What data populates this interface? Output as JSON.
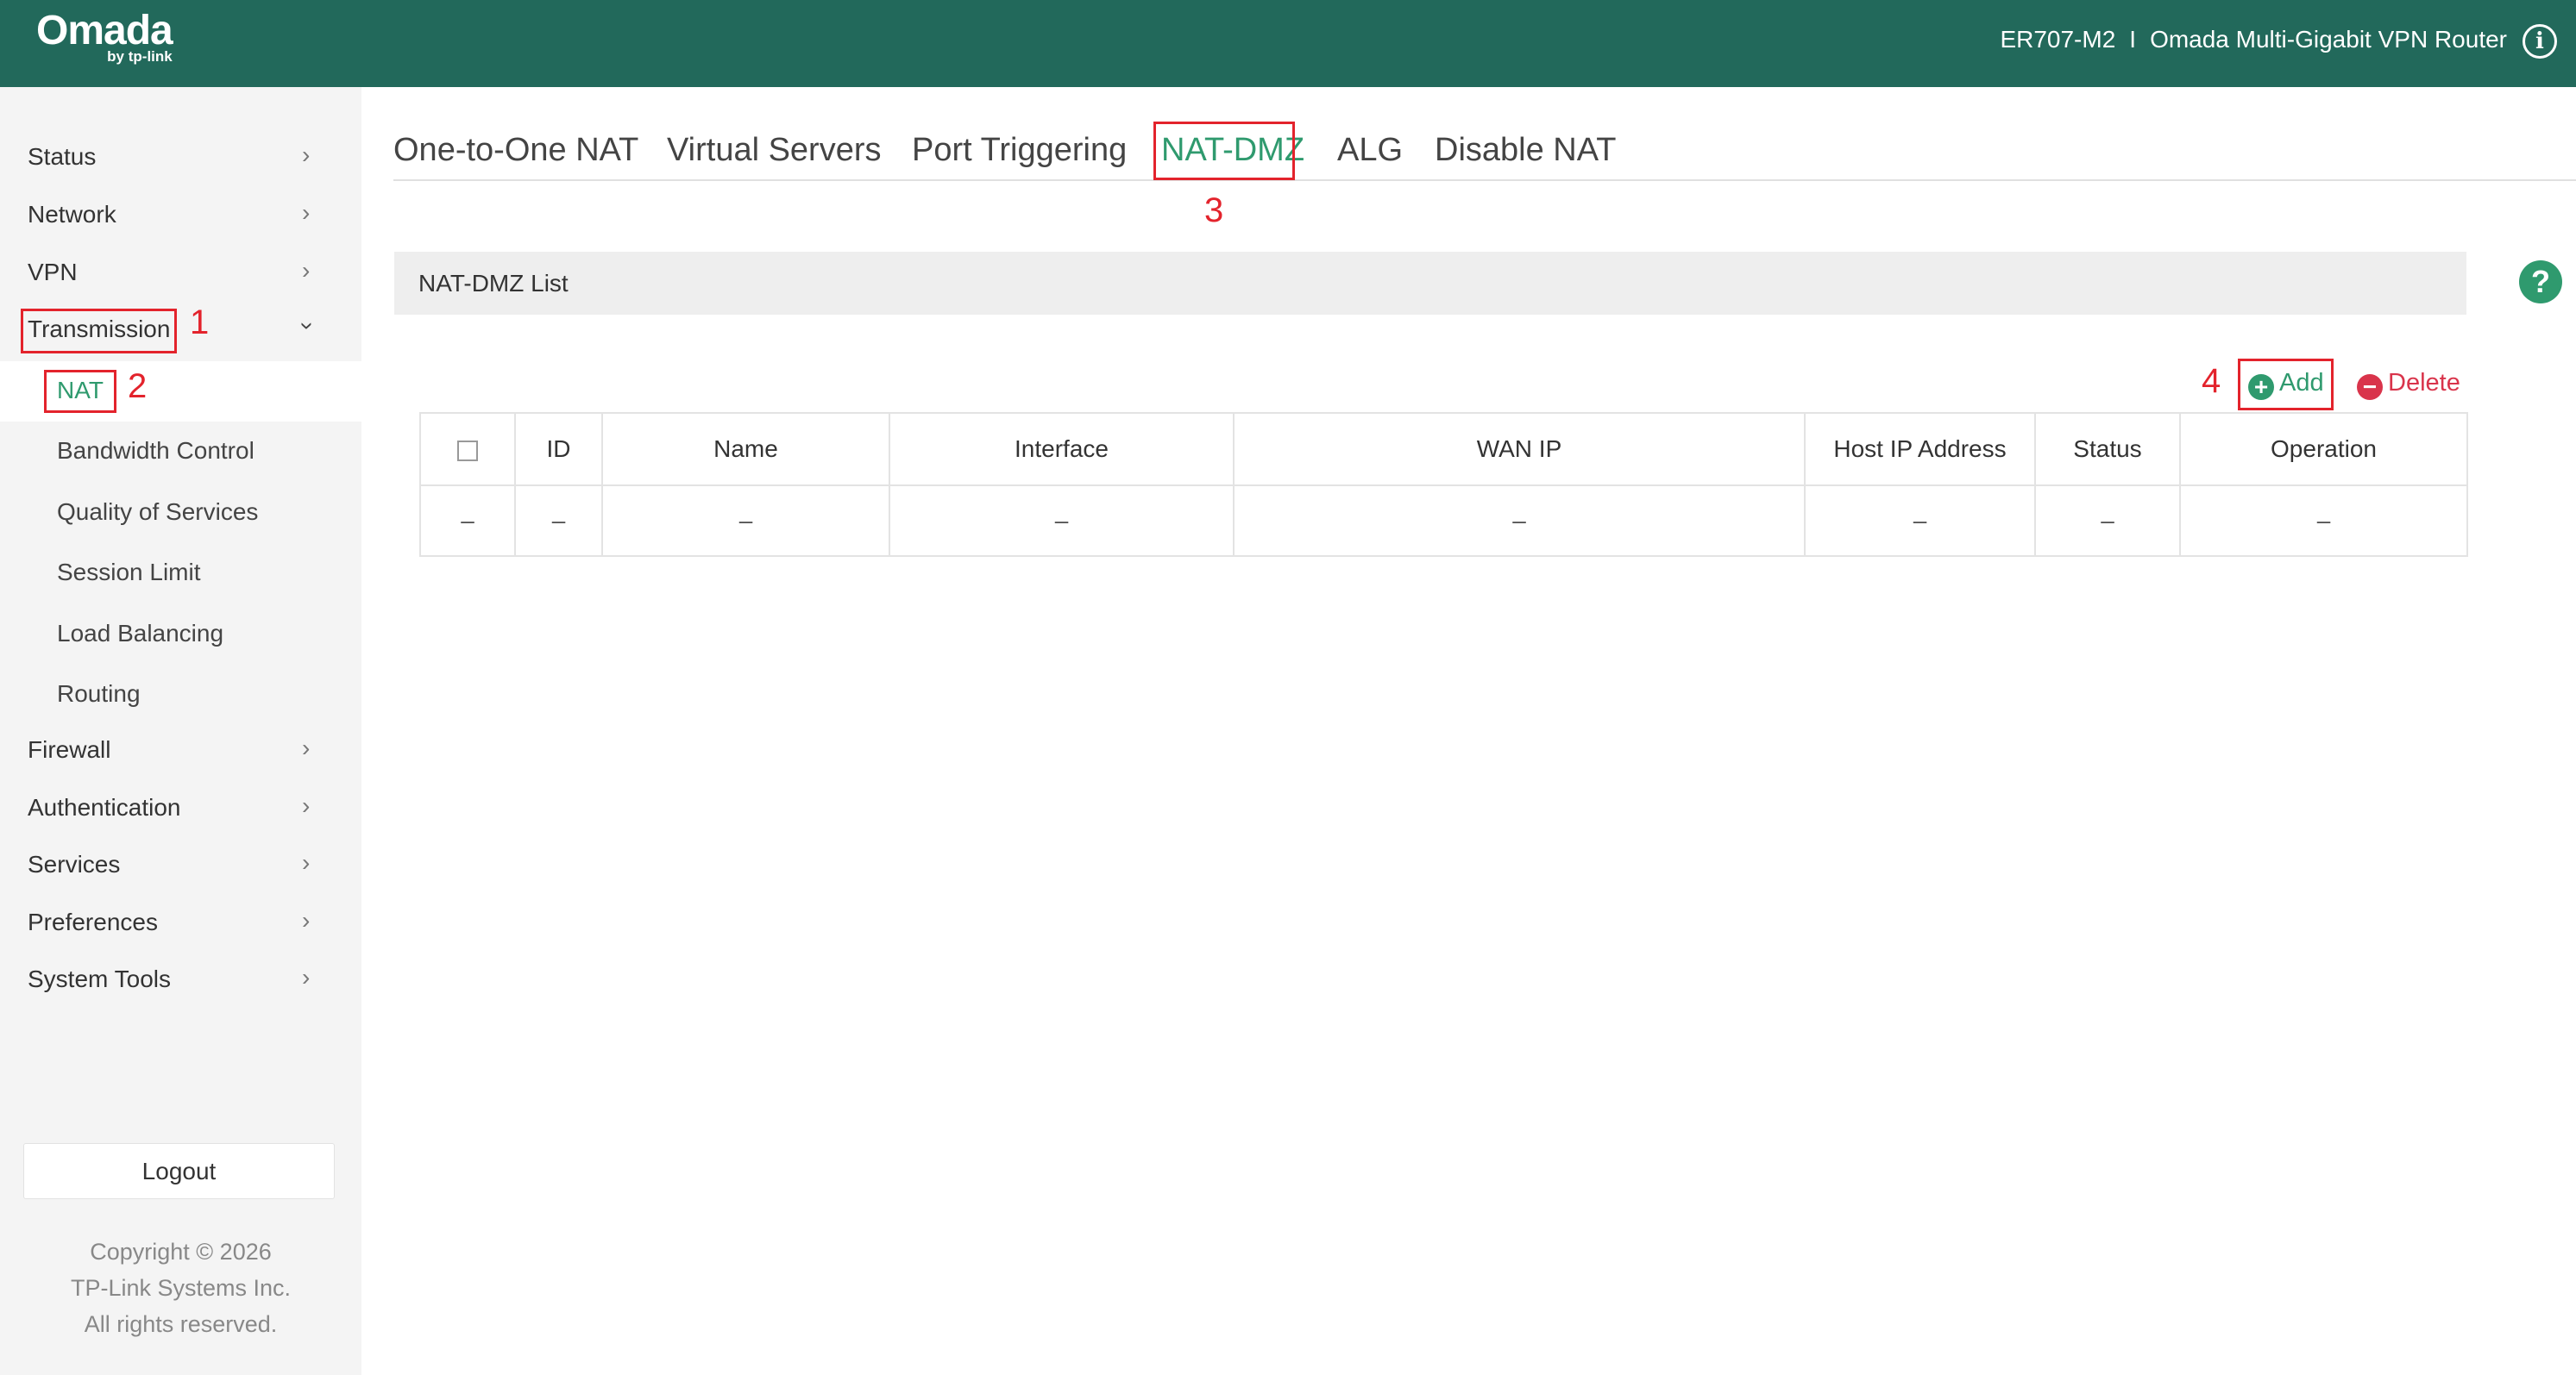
{
  "header": {
    "logo_text": "Omada",
    "logo_sub": "by tp-link",
    "model": "ER707-M2",
    "separator": "I",
    "product": "Omada Multi-Gigabit VPN Router",
    "info_glyph": "i",
    "info_icon": "info-circle-icon"
  },
  "sidebar": {
    "items": [
      {
        "label": "Status"
      },
      {
        "label": "Network"
      },
      {
        "label": "VPN"
      },
      {
        "label": "Transmission"
      },
      {
        "label": "Firewall"
      },
      {
        "label": "Authentication"
      },
      {
        "label": "Services"
      },
      {
        "label": "Preferences"
      },
      {
        "label": "System Tools"
      }
    ],
    "sub_items": [
      {
        "label": "NAT"
      },
      {
        "label": "Bandwidth Control"
      },
      {
        "label": "Quality of Services"
      },
      {
        "label": "Session Limit"
      },
      {
        "label": "Load Balancing"
      },
      {
        "label": "Routing"
      }
    ],
    "chevron_glyph": "›",
    "logout_label": "Logout",
    "copyright_line1": "Copyright  © 2026",
    "copyright_line2": "TP-Link Systems Inc.",
    "copyright_line3": "All rights reserved."
  },
  "tabs": [
    {
      "label": "One-to-One NAT"
    },
    {
      "label": "Virtual Servers"
    },
    {
      "label": "Port Triggering"
    },
    {
      "label": "NAT-DMZ"
    },
    {
      "label": "ALG"
    },
    {
      "label": "Disable NAT"
    }
  ],
  "active_tab": "NAT-DMZ",
  "list": {
    "title": "NAT-DMZ List",
    "help_glyph": "?",
    "add_glyph": "+",
    "add_label": "Add",
    "delete_glyph": "−",
    "delete_label": "Delete",
    "columns": [
      "ID",
      "Name",
      "Interface",
      "WAN IP",
      "Host IP Address",
      "Status",
      "Operation"
    ],
    "rows": [
      [
        "–",
        "–",
        "–",
        "–",
        "–",
        "–",
        "–",
        "–"
      ]
    ]
  },
  "annotations": [
    "1",
    "2",
    "3",
    "4"
  ],
  "colors": {
    "header_bg": "#22695b",
    "accent_green": "#2f9a6e",
    "annotation_red": "#e3232c",
    "delete_red": "#d9344b",
    "sidebar_bg": "#f4f4f4"
  }
}
